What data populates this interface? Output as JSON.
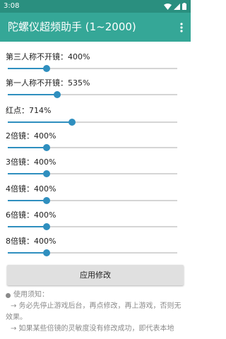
{
  "status_bar": {
    "time": "3:08"
  },
  "app_bar": {
    "title": "陀螺仪超频助手 (1~2000)"
  },
  "settings": [
    {
      "label": "第三人称不开镜：400%",
      "value_percent": 400,
      "slider_fraction": 0.23
    },
    {
      "label": "第一人称不开镜：535%",
      "value_percent": 535,
      "slider_fraction": 0.29
    },
    {
      "label": "红点：714%",
      "value_percent": 714,
      "slider_fraction": 0.38
    },
    {
      "label": "2倍镜：400%",
      "value_percent": 400,
      "slider_fraction": 0.23
    },
    {
      "label": "3倍镜：400%",
      "value_percent": 400,
      "slider_fraction": 0.23
    },
    {
      "label": "4倍镜：400%",
      "value_percent": 400,
      "slider_fraction": 0.23
    },
    {
      "label": "6倍镜：400%",
      "value_percent": 400,
      "slider_fraction": 0.23
    },
    {
      "label": "8倍镜：400%",
      "value_percent": 400,
      "slider_fraction": 0.23
    }
  ],
  "apply_button": {
    "label": "应用修改"
  },
  "notes": {
    "heading": "使用须知：",
    "lines": [
      "→ 务必先停止游戏后台，再点修改，再上游戏，否则无效果。",
      "→ 如果某些倍镜的灵敏度没有修改成功，即代表本地"
    ]
  },
  "colors": {
    "status_bar": "#2a8f7f",
    "app_bar": "#35a797",
    "slider_accent": "#2f8fbf",
    "button_bg": "#e0e0e0"
  },
  "icons": [
    "wifi-icon",
    "cellular-signal-icon",
    "battery-icon",
    "more-vert-icon"
  ]
}
